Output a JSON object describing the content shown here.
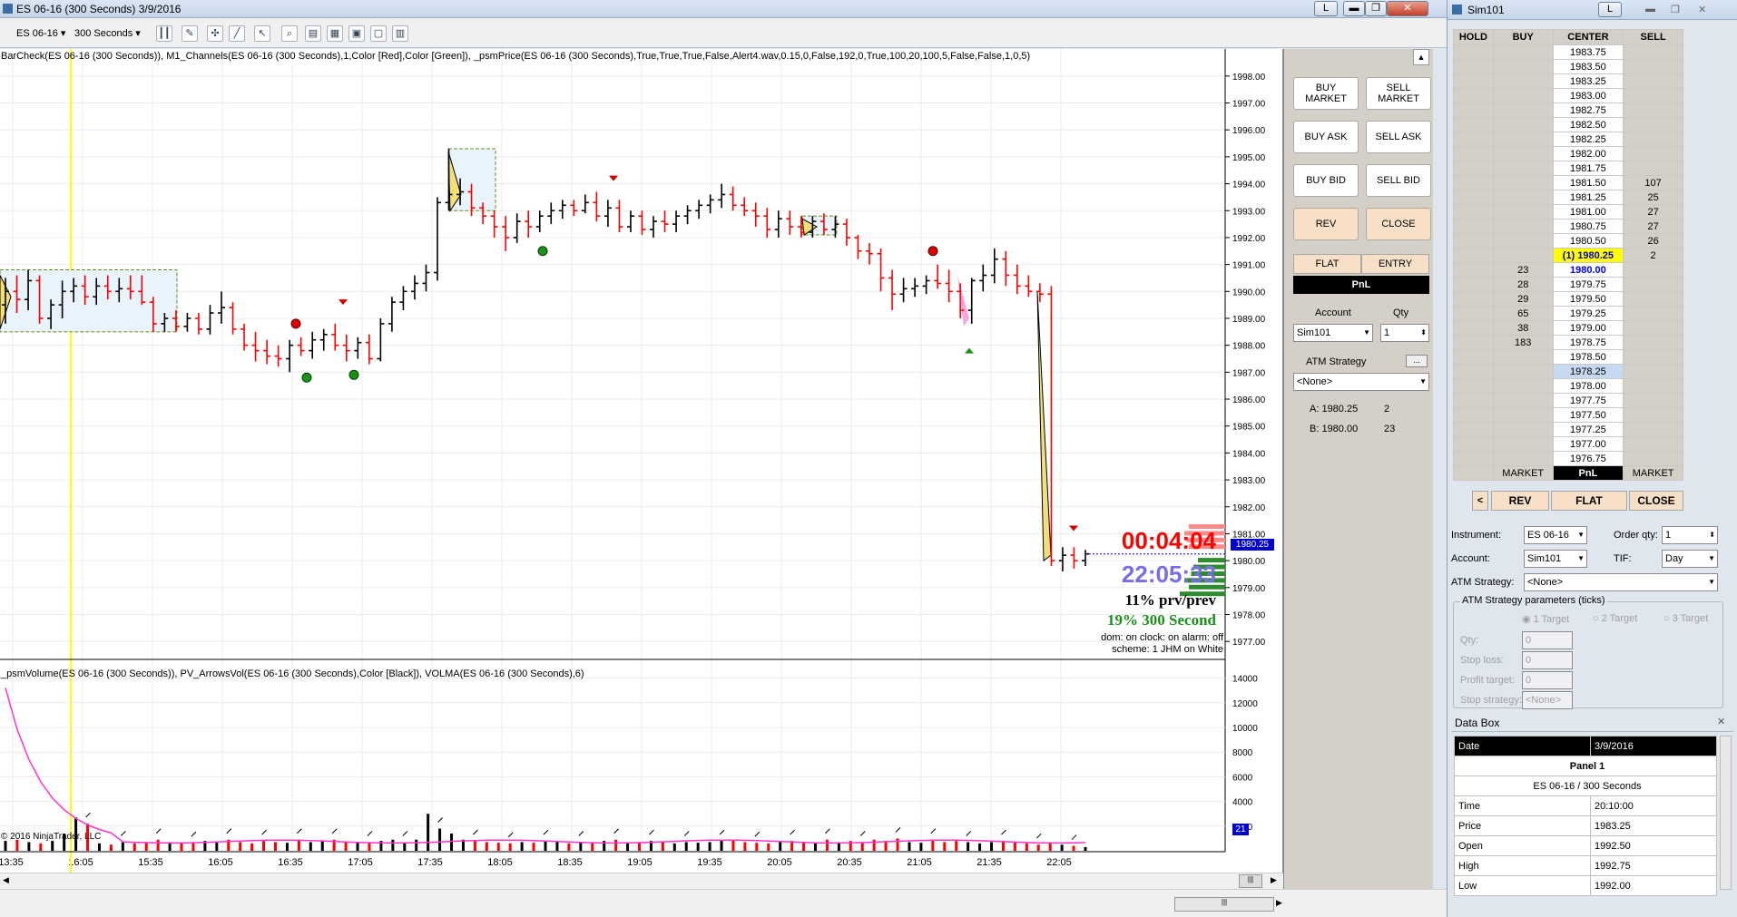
{
  "window": {
    "title": "ES 06-16 (300 Seconds)  3/9/2016",
    "l_button": "L",
    "min": "▬",
    "max": "❐",
    "close": "✕"
  },
  "toolbar": {
    "instrument": "ES 06-16",
    "interval": "300 Seconds"
  },
  "chart": {
    "indicator_text_price": "BarCheck(ES 06-16 (300 Seconds)), M1_Channels(ES 06-16 (300 Seconds),1,Color [Red],Color [Green]), _psmPrice(ES 06-16 (300 Seconds),True,True,True,False,Alert4.wav,0.15,0,False,192,0,True,100,20,100,5,False,False,1,0,5)",
    "indicator_text_volume": "_psmVolume(ES 06-16 (300 Seconds)), PV_ArrowsVol(ES 06-16 (300 Seconds),Color [Black]), VOLMA(ES 06-16 (300 Seconds),6)",
    "copyright": "© 2016 NinjaTrader, LLC",
    "current_price_label": "1980.25",
    "volume_label": "21",
    "overlay": {
      "timer": "00:04:04",
      "clock": "22:05:33",
      "prv": "11% prv/prev",
      "period": "19% 300 Second",
      "status": "dom: on clock: on alarm: off",
      "scheme": "scheme: 1 JHM on White"
    },
    "colors": {
      "up": "#000000",
      "down": "#ff0000",
      "signal_green": "#1a8f1a",
      "volma": "#ff33cc",
      "highlight": "#ffff00"
    }
  },
  "chart_data": {
    "type": "bar",
    "price_axis_ticks": [
      1998,
      1997,
      1996,
      1995,
      1994,
      1993,
      1992,
      1991,
      1990,
      1989,
      1988,
      1987,
      1986,
      1985,
      1984,
      1983,
      1982,
      1981,
      1980,
      1979,
      1978,
      1977
    ],
    "price_axis_labels": [
      "1998.00",
      "1997.00",
      "1996.00",
      "1995.00",
      "1994.00",
      "1993.00",
      "1992.00",
      "1991.00",
      "1990.00",
      "1989.00",
      "1988.00",
      "1987.00",
      "1986.00",
      "1985.00",
      "1984.00",
      "1983.00",
      "1982.00",
      "1981.00",
      "1980.00",
      "1979.00",
      "1978.00",
      "1977.00"
    ],
    "volume_axis_ticks": [
      14000,
      12000,
      10000,
      8000,
      6000,
      4000,
      2000
    ],
    "time_labels": [
      "13:35",
      "16:05",
      "15:35",
      "16:05",
      "16:35",
      "17:05",
      "17:35",
      "18:05",
      "18:35",
      "19:05",
      "19:35",
      "20:05",
      "20:35",
      "21:05",
      "21:35",
      "22:05"
    ],
    "ylim": [
      1976.5,
      1998.5
    ],
    "bars": [
      [
        1989.5,
        1990.5,
        1988.8,
        1990.0
      ],
      [
        1990.0,
        1990.6,
        1989.2,
        1989.7
      ],
      [
        1989.7,
        1990.8,
        1989.3,
        1990.4
      ],
      [
        1990.4,
        1990.6,
        1988.8,
        1989.0
      ],
      [
        1989.0,
        1989.7,
        1988.6,
        1989.5
      ],
      [
        1989.5,
        1990.4,
        1989.0,
        1990.0
      ],
      [
        1990.0,
        1990.5,
        1989.6,
        1990.2
      ],
      [
        1990.2,
        1990.6,
        1989.5,
        1989.8
      ],
      [
        1989.8,
        1990.5,
        1989.5,
        1990.2
      ],
      [
        1990.2,
        1990.6,
        1989.7,
        1990.0
      ],
      [
        1990.0,
        1990.5,
        1989.6,
        1990.1
      ],
      [
        1990.1,
        1990.6,
        1989.7,
        1990.0
      ],
      [
        1990.0,
        1990.6,
        1989.5,
        1989.6
      ],
      [
        1989.6,
        1989.8,
        1988.5,
        1988.8
      ],
      [
        1988.8,
        1989.2,
        1988.5,
        1989.0
      ],
      [
        1989.0,
        1989.3,
        1988.5,
        1988.7
      ],
      [
        1988.7,
        1989.2,
        1988.5,
        1989.0
      ],
      [
        1989.0,
        1989.2,
        1988.4,
        1988.6
      ],
      [
        1988.6,
        1989.5,
        1988.4,
        1989.2
      ],
      [
        1989.2,
        1990.0,
        1988.8,
        1989.4
      ],
      [
        1989.4,
        1989.6,
        1988.4,
        1988.6
      ],
      [
        1988.6,
        1988.8,
        1987.8,
        1988.0
      ],
      [
        1988.0,
        1988.5,
        1987.4,
        1987.8
      ],
      [
        1987.8,
        1988.2,
        1987.3,
        1987.6
      ],
      [
        1987.6,
        1988.0,
        1987.2,
        1987.5
      ],
      [
        1987.5,
        1988.2,
        1987.0,
        1988.0
      ],
      [
        1988.0,
        1988.3,
        1987.6,
        1987.8
      ],
      [
        1987.8,
        1988.5,
        1987.5,
        1988.2
      ],
      [
        1988.2,
        1988.6,
        1987.8,
        1988.4
      ],
      [
        1988.4,
        1988.8,
        1987.8,
        1988.0
      ],
      [
        1988.0,
        1988.4,
        1987.4,
        1987.8
      ],
      [
        1987.8,
        1988.3,
        1987.5,
        1988.1
      ],
      [
        1988.1,
        1988.4,
        1987.3,
        1987.5
      ],
      [
        1987.5,
        1989.0,
        1987.4,
        1988.8
      ],
      [
        1988.8,
        1989.8,
        1988.5,
        1989.6
      ],
      [
        1989.6,
        1990.2,
        1989.3,
        1990.0
      ],
      [
        1990.0,
        1990.6,
        1989.7,
        1990.3
      ],
      [
        1990.3,
        1991.0,
        1990.0,
        1990.7
      ],
      [
        1990.7,
        1993.5,
        1990.4,
        1993.3
      ],
      [
        1993.3,
        1995.3,
        1993.0,
        1993.6
      ],
      [
        1993.6,
        1994.2,
        1993.2,
        1993.7
      ],
      [
        1993.7,
        1994.0,
        1992.8,
        1993.1
      ],
      [
        1993.1,
        1993.3,
        1992.5,
        1992.8
      ],
      [
        1992.8,
        1993.0,
        1992.0,
        1992.4
      ],
      [
        1992.4,
        1992.8,
        1991.5,
        1992.0
      ],
      [
        1992.0,
        1992.9,
        1991.8,
        1992.6
      ],
      [
        1992.6,
        1993.0,
        1992.0,
        1992.4
      ],
      [
        1992.4,
        1993.0,
        1992.2,
        1992.8
      ],
      [
        1992.8,
        1993.3,
        1992.5,
        1993.0
      ],
      [
        1993.0,
        1993.4,
        1992.7,
        1993.2
      ],
      [
        1993.2,
        1993.4,
        1992.8,
        1993.0
      ],
      [
        1993.0,
        1993.6,
        1992.9,
        1993.3
      ],
      [
        1993.3,
        1993.7,
        1992.6,
        1992.8
      ],
      [
        1992.8,
        1993.4,
        1992.4,
        1993.1
      ],
      [
        1993.1,
        1993.4,
        1992.2,
        1992.4
      ],
      [
        1992.4,
        1993.0,
        1992.2,
        1992.8
      ],
      [
        1992.8,
        1993.0,
        1992.1,
        1992.3
      ],
      [
        1992.3,
        1992.8,
        1992.0,
        1992.6
      ],
      [
        1992.6,
        1993.0,
        1992.2,
        1992.5
      ],
      [
        1992.5,
        1993.0,
        1992.2,
        1992.8
      ],
      [
        1992.8,
        1993.2,
        1992.5,
        1993.0
      ],
      [
        1993.0,
        1993.4,
        1992.7,
        1993.2
      ],
      [
        1993.2,
        1993.6,
        1992.9,
        1993.4
      ],
      [
        1993.4,
        1994.0,
        1993.1,
        1993.6
      ],
      [
        1993.6,
        1993.9,
        1993.0,
        1993.2
      ],
      [
        1993.2,
        1993.5,
        1992.8,
        1993.0
      ],
      [
        1993.0,
        1993.3,
        1992.4,
        1992.8
      ],
      [
        1992.8,
        1993.1,
        1992.0,
        1992.3
      ],
      [
        1992.3,
        1993.0,
        1992.0,
        1992.7
      ],
      [
        1992.7,
        1993.0,
        1992.1,
        1992.4
      ],
      [
        1992.4,
        1992.8,
        1992.0,
        1992.2
      ],
      [
        1992.2,
        1992.8,
        1992.0,
        1992.6
      ],
      [
        1992.6,
        1992.9,
        1992.1,
        1992.3
      ],
      [
        1992.3,
        1992.8,
        1992.0,
        1992.5
      ],
      [
        1992.5,
        1992.7,
        1991.7,
        1992.0
      ],
      [
        1992.0,
        1992.1,
        1991.2,
        1991.5
      ],
      [
        1991.5,
        1991.8,
        1991.0,
        1991.4
      ],
      [
        1991.4,
        1991.6,
        1990.0,
        1990.5
      ],
      [
        1990.5,
        1990.8,
        1989.3,
        1989.9
      ],
      [
        1989.9,
        1990.5,
        1989.6,
        1990.1
      ],
      [
        1990.1,
        1990.5,
        1989.8,
        1990.2
      ],
      [
        1990.2,
        1990.6,
        1989.9,
        1990.4
      ],
      [
        1990.4,
        1991.0,
        1990.1,
        1990.3
      ],
      [
        1990.3,
        1990.8,
        1989.6,
        1990.0
      ],
      [
        1990.0,
        1990.3,
        1989.0,
        1989.3
      ],
      [
        1989.3,
        1990.5,
        1988.8,
        1990.4
      ],
      [
        1990.4,
        1991.0,
        1990.0,
        1990.6
      ],
      [
        1990.6,
        1991.6,
        1990.3,
        1991.2
      ],
      [
        1991.2,
        1991.5,
        1990.2,
        1990.6
      ],
      [
        1990.6,
        1991.0,
        1989.9,
        1990.2
      ],
      [
        1990.2,
        1990.6,
        1989.8,
        1990.0
      ],
      [
        1990.0,
        1990.3,
        1989.6,
        1989.9
      ],
      [
        1989.9,
        1990.2,
        1979.8,
        1980.0
      ],
      [
        1980.0,
        1980.5,
        1979.6,
        1980.2
      ],
      [
        1980.2,
        1980.5,
        1979.7,
        1980.0
      ],
      [
        1980.0,
        1980.4,
        1979.8,
        1980.25
      ]
    ],
    "volume": [
      800,
      900,
      700,
      600,
      800,
      1400,
      2700,
      2200,
      600,
      500,
      700,
      600,
      650,
      900,
      700,
      600,
      650,
      800,
      700,
      900,
      700,
      600,
      800,
      700,
      650,
      900,
      700,
      800,
      900,
      700,
      650,
      700,
      800,
      900,
      700,
      900,
      3000,
      1800,
      1400,
      900,
      800,
      700,
      650,
      600,
      700,
      650,
      800,
      700,
      600,
      700,
      650,
      800,
      900,
      700,
      650,
      800,
      700,
      600,
      700,
      650,
      700,
      800,
      900,
      700,
      650,
      600,
      700,
      800,
      700,
      650,
      900,
      700,
      800,
      700,
      900,
      800,
      1000,
      700,
      650,
      900,
      700,
      800,
      700,
      600,
      700,
      800,
      700,
      600,
      500,
      600,
      500,
      400,
      300
    ]
  },
  "side": {
    "buy_market": "BUY MARKET",
    "sell_market": "SELL MARKET",
    "buy_ask": "BUY ASK",
    "sell_ask": "SELL ASK",
    "buy_bid": "BUY BID",
    "sell_bid": "SELL BID",
    "rev": "REV",
    "close": "CLOSE",
    "flat": "FLAT",
    "entry": "ENTRY",
    "pnl": "PnL",
    "account_label": "Account",
    "qty_label": "Qty",
    "account": "Sim101",
    "qty": "1",
    "atm_label": "ATM Strategy",
    "atm_value": "<None>",
    "ask_line": "A: 1980.25",
    "ask_size": "2",
    "bid_line": "B: 1980.00",
    "bid_size": "23"
  },
  "sim": {
    "title": "Sim101",
    "l_button": "L",
    "headers": {
      "hold": "HOLD",
      "buy": "BUY",
      "center": "CENTER",
      "sell": "SELL"
    },
    "ladder": [
      {
        "buy": "",
        "price": "1983.75",
        "sell": ""
      },
      {
        "buy": "",
        "price": "1983.50",
        "sell": ""
      },
      {
        "buy": "",
        "price": "1983.25",
        "sell": ""
      },
      {
        "buy": "",
        "price": "1983.00",
        "sell": ""
      },
      {
        "buy": "",
        "price": "1982.75",
        "sell": ""
      },
      {
        "buy": "",
        "price": "1982.50",
        "sell": ""
      },
      {
        "buy": "",
        "price": "1982.25",
        "sell": ""
      },
      {
        "buy": "",
        "price": "1982.00",
        "sell": ""
      },
      {
        "buy": "",
        "price": "1981.75",
        "sell": ""
      },
      {
        "buy": "",
        "price": "1981.50",
        "sell": "107"
      },
      {
        "buy": "",
        "price": "1981.25",
        "sell": "25"
      },
      {
        "buy": "",
        "price": "1981.00",
        "sell": "27"
      },
      {
        "buy": "",
        "price": "1980.75",
        "sell": "27"
      },
      {
        "buy": "",
        "price": "1980.50",
        "sell": "26"
      },
      {
        "buy": "",
        "price": "(1) 1980.25",
        "sell": "2",
        "kind": "ask"
      },
      {
        "buy": "23",
        "price": "1980.00",
        "sell": "",
        "kind": "bid"
      },
      {
        "buy": "28",
        "price": "1979.75",
        "sell": ""
      },
      {
        "buy": "29",
        "price": "1979.50",
        "sell": ""
      },
      {
        "buy": "65",
        "price": "1979.25",
        "sell": ""
      },
      {
        "buy": "38",
        "price": "1979.00",
        "sell": ""
      },
      {
        "buy": "183",
        "price": "1978.75",
        "sell": ""
      },
      {
        "buy": "",
        "price": "1978.50",
        "sell": ""
      },
      {
        "buy": "",
        "price": "1978.25",
        "sell": "",
        "kind": "last"
      },
      {
        "buy": "",
        "price": "1978.00",
        "sell": ""
      },
      {
        "buy": "",
        "price": "1977.75",
        "sell": ""
      },
      {
        "buy": "",
        "price": "1977.50",
        "sell": ""
      },
      {
        "buy": "",
        "price": "1977.25",
        "sell": ""
      },
      {
        "buy": "",
        "price": "1977.00",
        "sell": ""
      },
      {
        "buy": "",
        "price": "1976.75",
        "sell": ""
      }
    ],
    "market_buy": "MARKET",
    "pnl": "PnL",
    "market_sell": "MARKET",
    "prev": "<",
    "rev": "REV",
    "flat": "FLAT",
    "close": "CLOSE",
    "instrument_label": "Instrument:",
    "instrument": "ES 06-16",
    "order_qty_label": "Order qty:",
    "order_qty": "1",
    "account_label": "Account:",
    "account": "Sim101",
    "tif_label": "TIF:",
    "tif": "Day",
    "atm_label": "ATM Strategy:",
    "atm": "<None>",
    "params_label": "ATM Strategy parameters (ticks)",
    "t1": "1 Target",
    "t2": "2 Target",
    "t3": "3 Target",
    "qty_label": "Qty:",
    "stop_loss_label": "Stop loss:",
    "profit_target_label": "Profit target:",
    "stop_strategy_label": "Stop strategy:",
    "zero": "0",
    "none": "<None>"
  },
  "databox": {
    "title": "Data Box",
    "date_label": "Date",
    "date": "3/9/2016",
    "panel": "Panel 1",
    "series": "ES 06-16 / 300 Seconds",
    "rows": [
      {
        "k": "Time",
        "v": "20:10:00"
      },
      {
        "k": "Price",
        "v": "1983.25"
      },
      {
        "k": "Open",
        "v": "1992.50"
      },
      {
        "k": "High",
        "v": "1992.75"
      },
      {
        "k": "Low",
        "v": "1992.00"
      }
    ]
  }
}
